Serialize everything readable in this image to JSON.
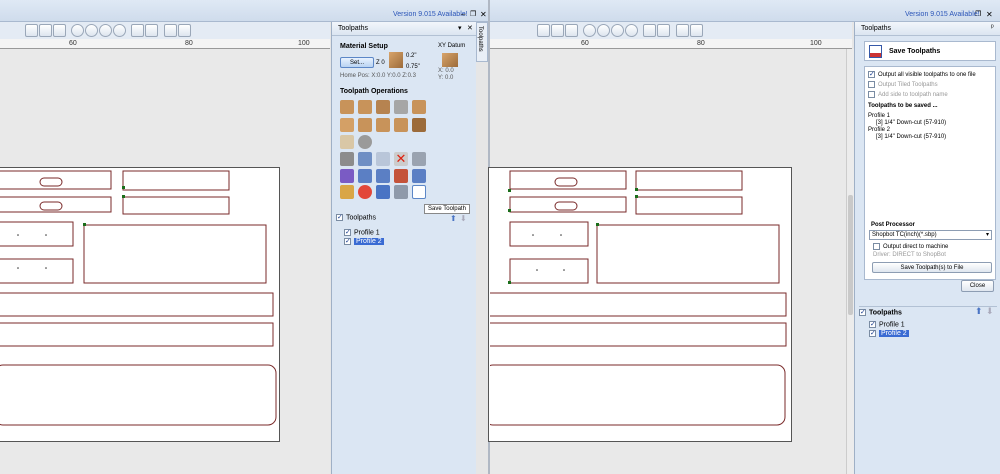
{
  "left": {
    "version_text": "Version 9.015 Available!",
    "ruler_labels": [
      "60",
      "80",
      "100"
    ],
    "panel": {
      "title": "Toolpaths",
      "side_tab": "Toolpaths",
      "material_setup": "Material Setup",
      "set_button": "Set...",
      "z_label": "Z 0",
      "dim_top": "0.2\"",
      "dim_bottom": "0.75\"",
      "home_pos": "Home Pos:  X:0.0 Y:0.0 Z:0.3",
      "xy_datum": "XY Datum",
      "xy_x": "X: 0.0",
      "xy_y": "Y: 0.0",
      "operations_title": "Toolpath Operations",
      "tooltip": "Save Toolpath",
      "list_header": "Toolpaths",
      "items": [
        "Profile 1",
        "Profile 2"
      ]
    }
  },
  "right": {
    "version_text": "Version 9.015 Available!",
    "ruler_labels": [
      "60",
      "80",
      "100"
    ],
    "panel": {
      "title": "Toolpaths",
      "header": "Save Toolpaths",
      "opt_output_all": "Output all visible toolpaths to one file",
      "opt_tiled": "Output Tiled Toolpaths",
      "opt_add_side": "Add side to toolpath name",
      "to_be_saved": "Toolpaths to be saved ...",
      "saved_list": [
        "Profile 1",
        "[3] 1/4\" Down-cut (57-910)",
        "Profile 2",
        "[3] 1/4\" Down-cut (57-910)"
      ],
      "post_processor": "Post Processor",
      "post_value": "Shopbot TC(inch)(*.sbp)",
      "output_direct": "Output direct to machine",
      "driver": "Driver: DIRECT to ShopBot",
      "save_button": "Save Toolpath(s) to File",
      "close_button": "Close",
      "list_header": "Toolpaths",
      "items": [
        "Profile 1",
        "Profile 2"
      ]
    }
  }
}
